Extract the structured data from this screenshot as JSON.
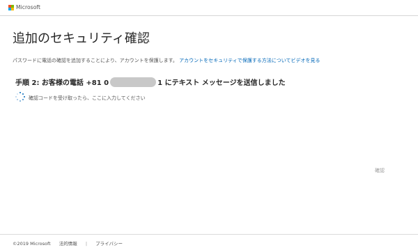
{
  "header": {
    "brand": "Microsoft",
    "logo_colors": [
      "#f25022",
      "#7fba00",
      "#00a4ef",
      "#ffb900"
    ]
  },
  "main": {
    "title": "追加のセキュリティ確認",
    "description": "パスワードに電話の確認を追加することにより、アカウントを保護します。",
    "description_link": "アカウントをセキュリティで保護する方法についてビデオを見る",
    "step_prefix": "手順 2: お客様の電話 +81 0",
    "phone_suffix": "1",
    "step_suffix": " にテキスト メッセージを送信しました",
    "instruction": "確認コードを受け取ったら、ここに入力してください",
    "verify_button": "確認"
  },
  "footer": {
    "copyright": "©2019 Microsoft",
    "legal_link": "法的情報",
    "separator": "|",
    "privacy_link": "プライバシー"
  }
}
